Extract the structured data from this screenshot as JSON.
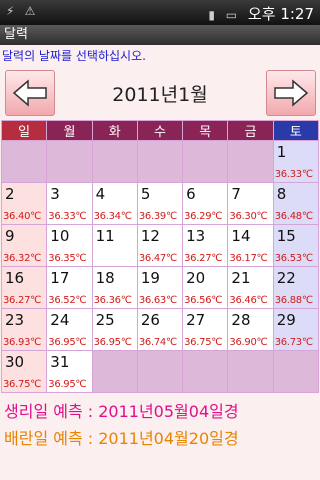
{
  "status_bar": {
    "icons": [
      "usb-icon",
      "warning-icon",
      "signal-icon",
      "battery-icon"
    ],
    "ampm": "오후",
    "time": "1:27"
  },
  "title_bar": {
    "title": "달력"
  },
  "instruction": "달력의 날짜를 선택하십시오.",
  "nav": {
    "prev_icon": "arrow-left-icon",
    "next_icon": "arrow-right-icon"
  },
  "month_title": "2011년1월",
  "weekdays": [
    "일",
    "월",
    "화",
    "수",
    "목",
    "금",
    "토"
  ],
  "weeks": [
    [
      {
        "day": "",
        "temp": ""
      },
      {
        "day": "",
        "temp": ""
      },
      {
        "day": "",
        "temp": ""
      },
      {
        "day": "",
        "temp": ""
      },
      {
        "day": "",
        "temp": ""
      },
      {
        "day": "",
        "temp": ""
      },
      {
        "day": "1",
        "temp": "36.33℃"
      }
    ],
    [
      {
        "day": "2",
        "temp": "36.40℃"
      },
      {
        "day": "3",
        "temp": "36.33℃"
      },
      {
        "day": "4",
        "temp": "36.34℃"
      },
      {
        "day": "5",
        "temp": "36.39℃"
      },
      {
        "day": "6",
        "temp": "36.29℃"
      },
      {
        "day": "7",
        "temp": "36.30℃"
      },
      {
        "day": "8",
        "temp": "36.48℃"
      }
    ],
    [
      {
        "day": "9",
        "temp": "36.32℃"
      },
      {
        "day": "10",
        "temp": "36.35℃"
      },
      {
        "day": "11",
        "temp": ""
      },
      {
        "day": "12",
        "temp": "36.47℃"
      },
      {
        "day": "13",
        "temp": "36.27℃"
      },
      {
        "day": "14",
        "temp": "36.17℃"
      },
      {
        "day": "15",
        "temp": "36.53℃"
      }
    ],
    [
      {
        "day": "16",
        "temp": "36.27℃"
      },
      {
        "day": "17",
        "temp": "36.52℃"
      },
      {
        "day": "18",
        "temp": "36.36℃"
      },
      {
        "day": "19",
        "temp": "36.63℃"
      },
      {
        "day": "20",
        "temp": "36.56℃"
      },
      {
        "day": "21",
        "temp": "36.46℃"
      },
      {
        "day": "22",
        "temp": "36.88℃"
      }
    ],
    [
      {
        "day": "23",
        "temp": "36.93℃"
      },
      {
        "day": "24",
        "temp": "36.95℃"
      },
      {
        "day": "25",
        "temp": "36.95℃"
      },
      {
        "day": "26",
        "temp": "36.74℃"
      },
      {
        "day": "27",
        "temp": "36.75℃"
      },
      {
        "day": "28",
        "temp": "36.90℃"
      },
      {
        "day": "29",
        "temp": "36.73℃"
      }
    ],
    [
      {
        "day": "30",
        "temp": "36.75℃"
      },
      {
        "day": "31",
        "temp": "36.95℃"
      },
      {
        "day": "",
        "temp": ""
      },
      {
        "day": "",
        "temp": ""
      },
      {
        "day": "",
        "temp": ""
      },
      {
        "day": "",
        "temp": ""
      },
      {
        "day": "",
        "temp": ""
      }
    ]
  ],
  "predictions": {
    "period": "생리일 예측 : 2011년05월04일경",
    "ovulation": "배란일 예측 : 2011년04월20일경"
  },
  "colors": {
    "period": "#e0108a",
    "ovulation": "#e88400",
    "temperature": "#d21b1b",
    "sunday_header": "#b52d3f",
    "saturday_header": "#2a3aa8",
    "weekday_header": "#8b2456"
  }
}
